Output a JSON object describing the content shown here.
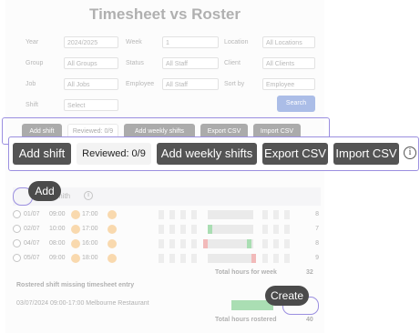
{
  "page": {
    "title": "Timesheet vs Roster"
  },
  "filters": {
    "year_label": "Year",
    "year_value": "2024/2025",
    "week_label": "Week",
    "week_value": "1",
    "location_label": "Location",
    "location_value": "All Locations",
    "group_label": "Group",
    "group_value": "All Groups",
    "status_label": "Status",
    "status_value": "All Staff",
    "client_label": "Client",
    "client_value": "All Clients",
    "job_label": "Job",
    "job_value": "All Jobs",
    "employee_label": "Employee",
    "employee_value": "All Staff",
    "sortby_label": "Sort by",
    "sortby_value": "Employee",
    "shift_label": "Shift",
    "shift_value": "Select",
    "search_label": "Search"
  },
  "toolbar": {
    "add_shift": "Add shift",
    "reviewed": "Reviewed: 0/9",
    "add_weekly": "Add weekly shifts",
    "export_csv": "Export CSV",
    "import_csv": "Import CSV",
    "info_glyph": "i"
  },
  "table": {
    "employee_name": "mith",
    "rows": [
      {
        "date": "01/07",
        "start": "09:00",
        "end": "17:00",
        "hours": "8"
      },
      {
        "date": "02/07",
        "start": "10:00",
        "end": "17:00",
        "hours": "7"
      },
      {
        "date": "04/07",
        "start": "08:00",
        "end": "16:00",
        "hours": "8"
      },
      {
        "date": "05/07",
        "start": "09:00",
        "end": "18:00",
        "hours": "9"
      }
    ],
    "total_week_label": "Total hours for week",
    "total_week_value": "32",
    "missing_title": "Rostered shift missing timesheet entry",
    "missing_row": "03/07/2024  09:00-17:00 Melbourne Restaurant",
    "total_rostered_label": "Total hours rostered",
    "total_rostered_value": "40"
  },
  "tooltips": {
    "add": "Add",
    "create": "Create"
  },
  "colors": {
    "button_dark": "#545454",
    "highlight": "#9b8fe0",
    "accent_blue": "#3a63c8",
    "pill_orange": "#f2a640",
    "bar_green": "#37b24d",
    "bar_red": "#e25c5c"
  }
}
